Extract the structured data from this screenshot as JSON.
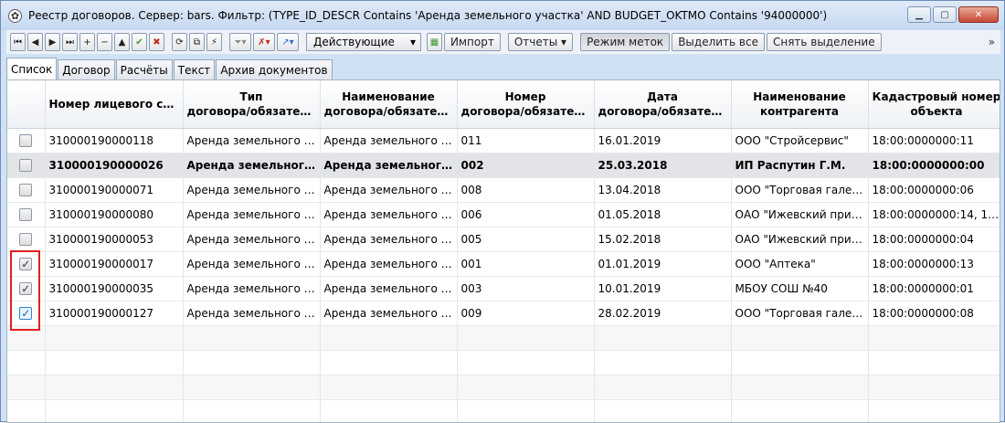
{
  "window": {
    "title": "Реестр договоров. Сервер: bars. Фильтр: (TYPE_ID_DESCR Contains 'Аренда земельного участка' AND BUDGET_OKTMO Contains '94000000')"
  },
  "toolbar": {
    "filter_dropdown": "Действующие",
    "import_label": "Импорт",
    "reports_label": "Отчеты",
    "mark_mode_label": "Режим меток",
    "select_all_label": "Выделить все",
    "clear_selection_label": "Снять выделение",
    "more_label": "»"
  },
  "tabs": [
    {
      "label": "Список"
    },
    {
      "label": "Договор"
    },
    {
      "label": "Расчёты"
    },
    {
      "label": "Текст"
    },
    {
      "label": "Архив документов"
    }
  ],
  "columns": [
    {
      "line1": "Номер лицевого счёта",
      "line2": ""
    },
    {
      "line1": "Тип",
      "line2": "договора/обязательс..."
    },
    {
      "line1": "Наименование",
      "line2": "договора/обязательс..."
    },
    {
      "line1": "Номер",
      "line2": "договора/обязател..."
    },
    {
      "line1": "Дата",
      "line2": "договора/обязательс..."
    },
    {
      "line1": "Наименование",
      "line2": "контрагента"
    },
    {
      "line1": "Кадастровый номер",
      "line2": "объекта"
    }
  ],
  "rows": [
    {
      "checked": false,
      "account": "310000190000118",
      "type": "Аренда земельного уча...",
      "name": "Аренда земельного уча...",
      "number": "011",
      "date": "16.01.2019",
      "counterparty": "ООО \"Стройсервис\"",
      "cadastral": "18:00:0000000:11"
    },
    {
      "checked": false,
      "account": "310000190000026",
      "type": "Аренда земельного у...",
      "name": "Аренда земельного у...",
      "number": "002",
      "date": "25.03.2018",
      "counterparty": "ИП Распутин Г.М.",
      "cadastral": "18:00:0000000:00"
    },
    {
      "checked": false,
      "account": "310000190000071",
      "type": "Аренда земельного уча...",
      "name": "Аренда земельного уча...",
      "number": "008",
      "date": "13.04.2018",
      "counterparty": "ООО \"Торговая галерея\"",
      "cadastral": "18:00:0000000:06"
    },
    {
      "checked": false,
      "account": "310000190000080",
      "type": "Аренда земельного уча...",
      "name": "Аренда земельного уча...",
      "number": "006",
      "date": "01.05.2018",
      "counterparty": "ОАО \"Ижевский прибо...",
      "cadastral": "18:00:0000000:14, 18:00:..."
    },
    {
      "checked": false,
      "account": "310000190000053",
      "type": "Аренда земельного уча...",
      "name": "Аренда земельного уча...",
      "number": "005",
      "date": "15.02.2018",
      "counterparty": "ОАО \"Ижевский прибо...",
      "cadastral": "18:00:0000000:04"
    },
    {
      "checked": true,
      "account": "310000190000017",
      "type": "Аренда земельного уча...",
      "name": "Аренда земельного уча...",
      "number": "001",
      "date": "01.01.2019",
      "counterparty": "ООО \"Аптека\"",
      "cadastral": "18:00:0000000:13"
    },
    {
      "checked": true,
      "account": "310000190000035",
      "type": "Аренда земельного уча...",
      "name": "Аренда земельного уча...",
      "number": "003",
      "date": "10.01.2019",
      "counterparty": "МБОУ СОШ №40",
      "cadastral": "18:00:0000000:01"
    },
    {
      "checked": true,
      "account": "310000190000127",
      "type": "Аренда земельного уча...",
      "name": "Аренда земельного уча...",
      "number": "009",
      "date": "28.02.2019",
      "counterparty": "ООО \"Торговая галерея\"",
      "cadastral": "18:00:0000000:08"
    }
  ]
}
